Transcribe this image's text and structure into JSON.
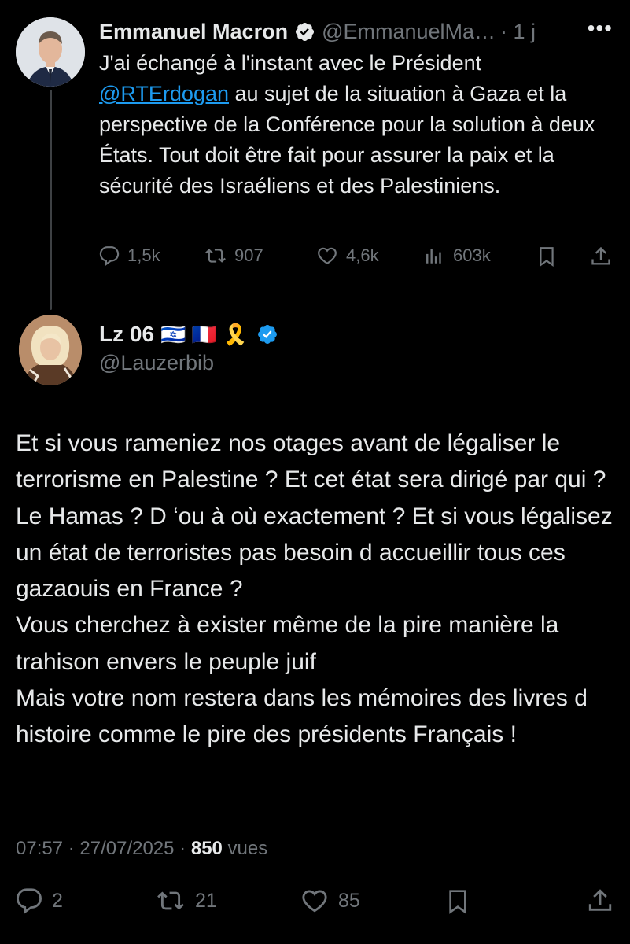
{
  "original_tweet": {
    "author_name": "Emmanuel Macron",
    "handle": "@EmmanuelMa…",
    "time": "· 1 j",
    "more": "•••",
    "text_before": "J'ai échangé à l'instant avec le Président ",
    "mention": "@RTErdogan",
    "text_after": " au sujet de la situation à Gaza et la perspective de la Conférence pour la solution à deux États. Tout doit être fait pour assurer la paix et la sécurité des Israéliens et des Palestiniens.",
    "stats": {
      "replies": "1,5k",
      "retweets": "907",
      "likes": "4,6k",
      "views": "603k"
    }
  },
  "reply_tweet": {
    "author_name": "Lz 06",
    "emojis": "🇮🇱 🇫🇷 🎗️",
    "handle": "@Lauzerbib",
    "text": "Et si vous rameniez nos otages avant de légaliser le terrorisme en Palestine ? Et cet état sera dirigé par qui ? Le Hamas ? D ‘ou à où exactement ? Et si vous légalisez un état de terroristes pas besoin d accueillir tous ces gazaouis en France ?\nVous cherchez à exister même de la pire manière la trahison envers le peuple juif\nMais votre nom restera dans les mémoires des livres d histoire comme le pire  des présidents Français !",
    "timestamp": "07:57 · 27/07/2025 · ",
    "views_count": "850",
    "views_label": " vues",
    "stats": {
      "replies": "2",
      "retweets": "21",
      "likes": "85"
    }
  },
  "colors": {
    "background": "#000000",
    "text": "#e7e9ea",
    "muted": "#71767b",
    "link": "#1d9bf0",
    "verified": "#1d9bf0"
  }
}
